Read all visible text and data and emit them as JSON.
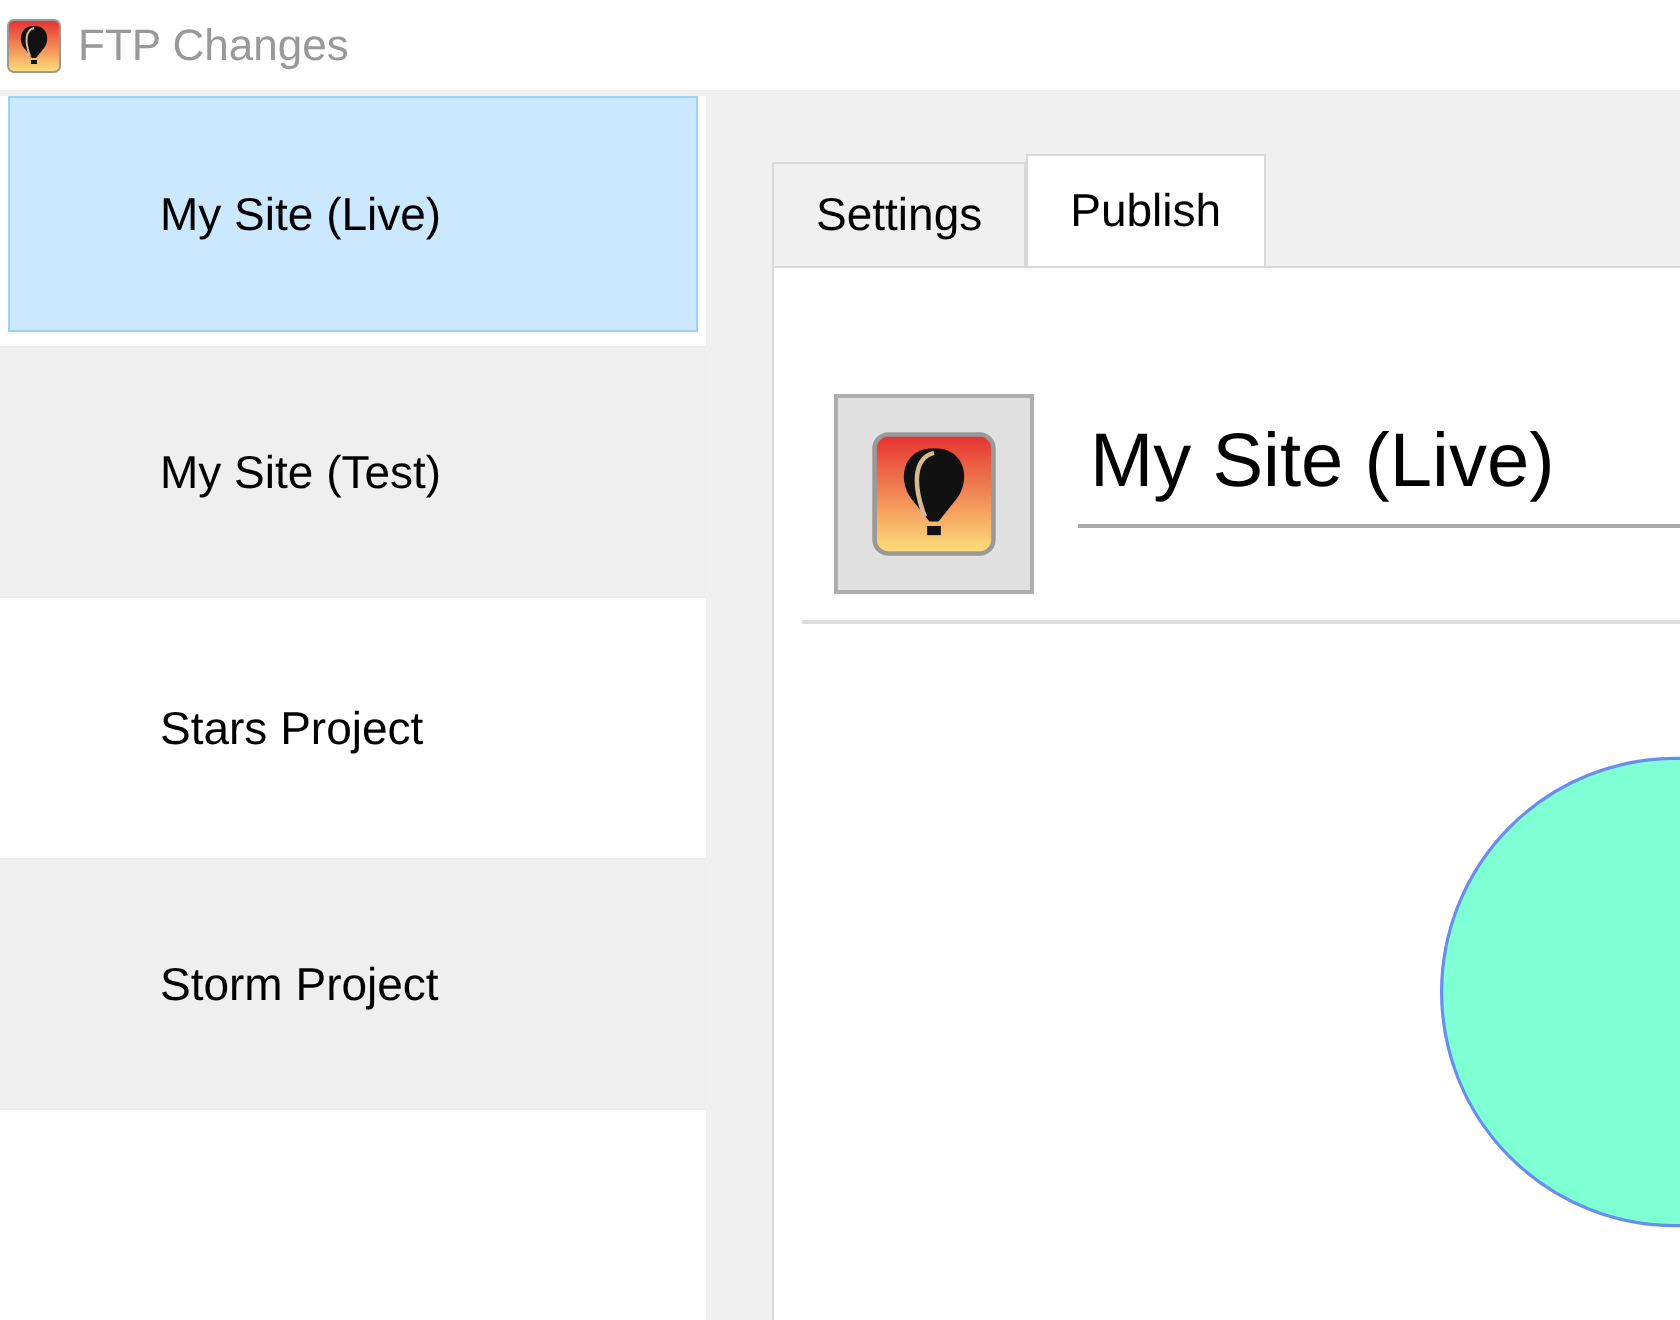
{
  "window": {
    "title": "FTP Changes"
  },
  "sidebar": {
    "items": [
      {
        "label": "My Site (Live)",
        "selected": true
      },
      {
        "label": "My Site (Test)",
        "selected": false
      },
      {
        "label": "Stars Project",
        "selected": false
      },
      {
        "label": "Storm Project",
        "selected": false
      }
    ]
  },
  "tabs": [
    {
      "label": "Settings",
      "selected": false
    },
    {
      "label": "Publish",
      "selected": true
    }
  ],
  "site_name": {
    "value": "My Site (Live)"
  }
}
